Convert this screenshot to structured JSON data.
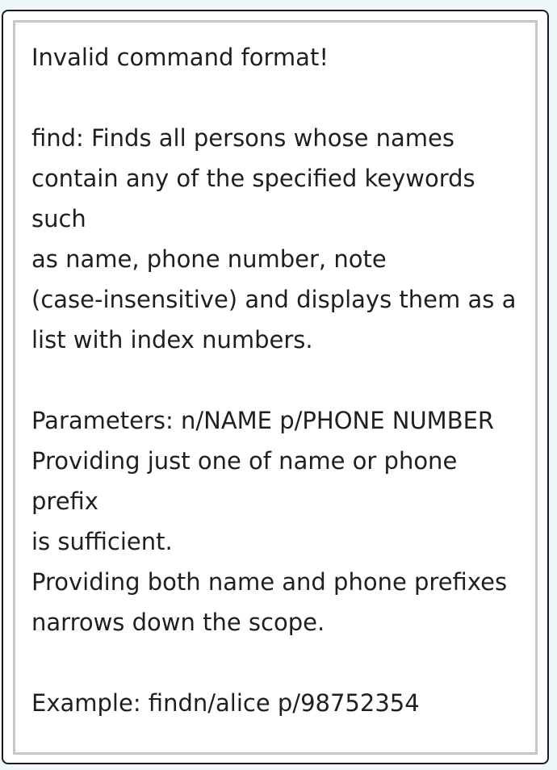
{
  "result_display": {
    "text": "Invalid command format!\n\nfind: Finds all persons whose names\ncontain any of the specified keywords such\nas name, phone number, note\n(case-insensitive) and displays them as a\nlist with index numbers.\n\nParameters: n/NAME p/PHONE NUMBER\nProviding just one of name or phone prefix\nis sufficient.\nProviding both name and phone prefixes\nnarrows down the scope.\n\nExample: findn/alice p/98752354"
  }
}
